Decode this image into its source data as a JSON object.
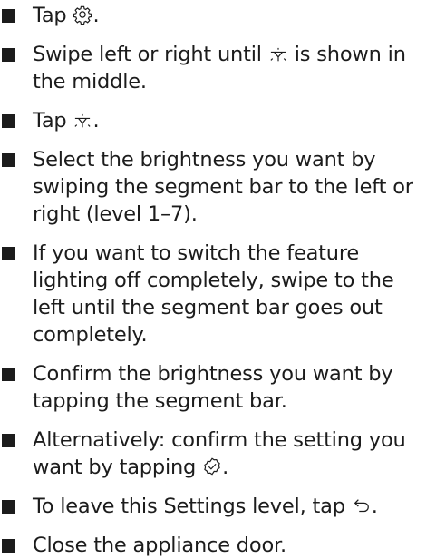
{
  "steps": [
    {
      "before": "Tap ",
      "icon": "gear-icon",
      "after": "."
    },
    {
      "before": "Swipe left or right until ",
      "icon": "lighting-icon",
      "after": " is shown in the middle."
    },
    {
      "before": "Tap ",
      "icon": "lighting-icon",
      "after": "."
    },
    {
      "text": "Select the brightness you want by swiping the segment bar to the left or right (level 1–7)."
    },
    {
      "text": "If you want to switch the feature lighting off completely, swipe to the left until the segment bar goes out completely."
    },
    {
      "text": "Confirm the brightness you want by tapping the segment bar."
    },
    {
      "before": "Alternatively: confirm the setting you want by tapping ",
      "icon": "confirm-check-icon",
      "after": "."
    },
    {
      "before": "To leave this Settings level, tap ",
      "icon": "back-arrow-icon",
      "after": "."
    },
    {
      "text": "Close the appliance door."
    }
  ]
}
